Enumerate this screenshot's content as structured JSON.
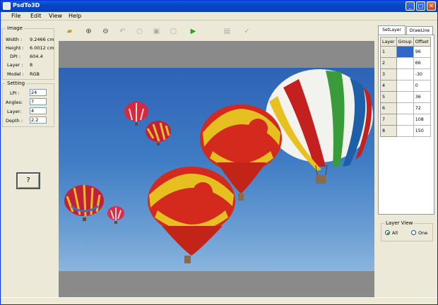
{
  "window": {
    "title": "PsdTo3D"
  },
  "menu": [
    "File",
    "Edit",
    "View",
    "Help"
  ],
  "image": {
    "group_label": "Image",
    "rows": [
      {
        "label": "Width :",
        "value": "9.2466 cm"
      },
      {
        "label": "Height :",
        "value": "6.0012 cm"
      },
      {
        "label": "DPI :",
        "value": "604.4"
      },
      {
        "label": "Layer :",
        "value": "8"
      },
      {
        "label": "Model :",
        "value": "RGB"
      }
    ]
  },
  "setting": {
    "group_label": "Setting",
    "rows": [
      {
        "label": "LPI :",
        "value": "24"
      },
      {
        "label": "Angles:",
        "value": "7"
      },
      {
        "label": "Layer:",
        "value": "4"
      },
      {
        "label": "Depth :",
        "value": "2.2"
      }
    ]
  },
  "help_button": "?",
  "toolbar": {
    "icons": [
      "open-folder-icon",
      "zoom-in-icon",
      "zoom-out-icon",
      "undo-icon",
      "circle-icon",
      "frame-icon",
      "frame2-icon",
      "play-icon",
      "save-icon",
      "check-icon"
    ]
  },
  "right": {
    "tabs": [
      "SetLayer",
      "DrawLine"
    ],
    "grid": {
      "headers": [
        "Layer",
        "Group",
        "Offset"
      ],
      "rows": [
        {
          "layer": "1",
          "group": "",
          "offset": "96"
        },
        {
          "layer": "2",
          "group": "",
          "offset": "66"
        },
        {
          "layer": "3",
          "group": "",
          "offset": "-30"
        },
        {
          "layer": "4",
          "group": "",
          "offset": "0"
        },
        {
          "layer": "5",
          "group": "",
          "offset": "36"
        },
        {
          "layer": "6",
          "group": "",
          "offset": "72"
        },
        {
          "layer": "7",
          "group": "",
          "offset": "108"
        },
        {
          "layer": "8",
          "group": "",
          "offset": "150"
        }
      ]
    },
    "layer_view": {
      "label": "Layer View",
      "all": "All",
      "one": "One",
      "selected": "All"
    }
  },
  "colors": {
    "titlebar": "#0a5fd8",
    "selection": "#3167c6"
  }
}
